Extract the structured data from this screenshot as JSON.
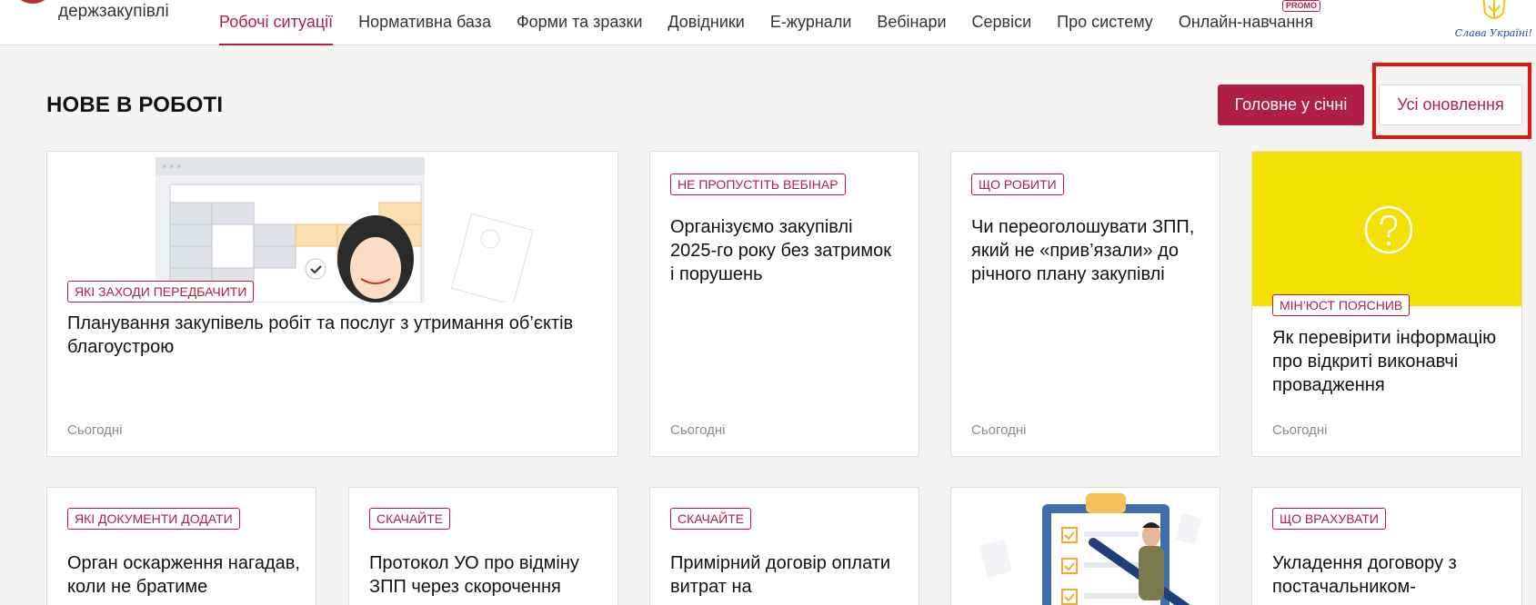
{
  "header": {
    "logo_text": "держзакупівлі",
    "nav": [
      {
        "label": "Робочі ситуації",
        "active": true
      },
      {
        "label": "Нормативна база"
      },
      {
        "label": "Форми та зразки"
      },
      {
        "label": "Довідники"
      },
      {
        "label": "Е-журнали"
      },
      {
        "label": "Вебінари"
      },
      {
        "label": "Сервіси"
      },
      {
        "label": "Про систему"
      },
      {
        "label": "Онлайн-навчання",
        "badge": "PROMO"
      }
    ],
    "slava": "Слава Україні!"
  },
  "section": {
    "title": "НОВЕ В РОБОТІ",
    "btn_primary": "Головне у січні",
    "btn_secondary": "Усі оновлення"
  },
  "cards": [
    {
      "tag": "ЯКІ ЗАХОДИ ПЕРЕДБАЧИТИ",
      "title": "Планування закупівель робіт та послуг з утримання об’єктів благоустрою",
      "date": "Сьогодні"
    },
    {
      "tag": "НЕ ПРОПУСТІТЬ ВЕБІНАР",
      "title": "Організуємо закупівлі 2025-го року без затримок і порушень",
      "date": "Сьогодні"
    },
    {
      "tag": "ЩО РОБИТИ",
      "title": "Чи переоголошувати ЗПП, який не «прив’язали» до річного плану закупівлі",
      "date": "Сьогодні"
    },
    {
      "tag": "МІН’ЮСТ ПОЯСНИВ",
      "title": "Як перевірити інформацію про відкриті виконавчі провадження",
      "date": "Сьогодні"
    },
    {
      "tag": "ЯКІ ДОКУМЕНТИ ДОДАТИ",
      "title": "Орган оскарження нагадав, коли не братиме"
    },
    {
      "tag": "СКАЧАЙТЕ",
      "title": "Протокол УО про відміну ЗПП через скорочення"
    },
    {
      "tag": "СКАЧАЙТЕ",
      "title": "Примірний договір оплати витрат на"
    },
    {
      "title": ""
    },
    {
      "tag": "ЩО ВРАХУВАТИ",
      "title": "Укладення договору з постачальником-"
    }
  ],
  "colors": {
    "accent": "#b01f45",
    "yellow": "#f3e104",
    "background": "#f5f4f2"
  }
}
